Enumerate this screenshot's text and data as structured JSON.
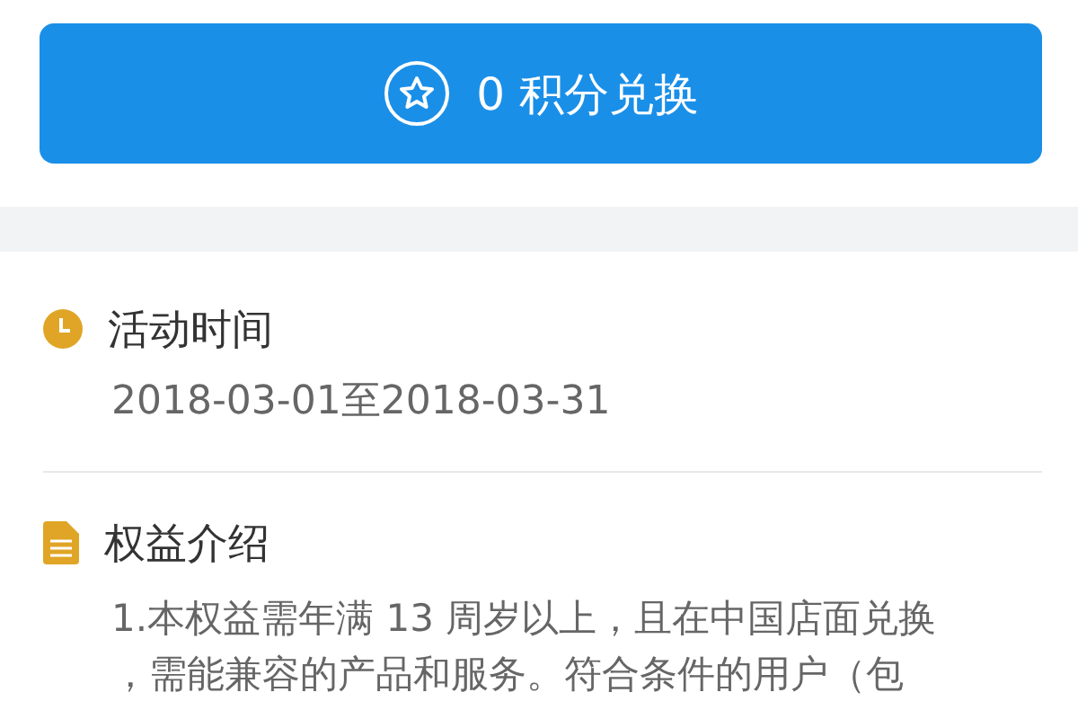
{
  "redeem_button": {
    "label": "0 积分兑换"
  },
  "sections": [
    {
      "kind": "time",
      "title": "活动时间",
      "body": "2018-03-01至2018-03-31"
    },
    {
      "kind": "doc",
      "title": "权益介绍",
      "body": "1.本权益需年满 13 周岁以上，且在中国店面兑换，需能兼容的产品和服务。符合条件的用户（包"
    }
  ]
}
